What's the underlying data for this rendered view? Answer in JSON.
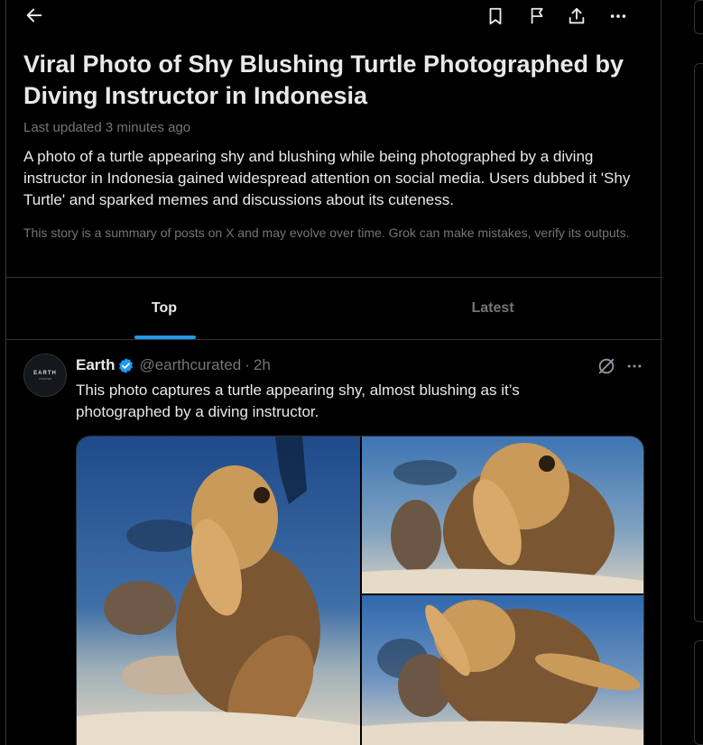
{
  "header": {
    "back_icon": "arrow-left-icon",
    "actions": [
      "bookmark-icon",
      "flag-icon",
      "share-icon",
      "more-icon"
    ]
  },
  "story": {
    "title": "Viral Photo of Shy Blushing Turtle Photographed by Diving Instructor in Indonesia",
    "updated": "Last updated 3 minutes ago",
    "summary": "A photo of a turtle appearing shy and blushing while being photographed by a diving instructor in Indonesia gained widespread attention on social media. Users dubbed it 'Shy Turtle' and sparked memes and discussions about its cuteness.",
    "disclaimer": "This story is a summary of posts on X and may evolve over time. Grok can make mistakes, verify its outputs."
  },
  "tabs": [
    {
      "label": "Top",
      "active": true
    },
    {
      "label": "Latest",
      "active": false
    }
  ],
  "post": {
    "avatar_text": "EARTH",
    "avatar_subtext": "CURATED",
    "author": "Earth",
    "handle": "@earthcurated",
    "separator": "·",
    "time": "2h",
    "text": "This photo captures a turtle appearing shy, almost blushing as it’s photographed by a diving instructor.",
    "images": [
      "turtle-photo-left",
      "turtle-photo-top-right",
      "turtle-photo-bottom-right"
    ]
  },
  "colors": {
    "background": "#000000",
    "text": "#e7e9ea",
    "muted": "#71767b",
    "accent": "#1d9bf0",
    "border": "#2f3336"
  }
}
